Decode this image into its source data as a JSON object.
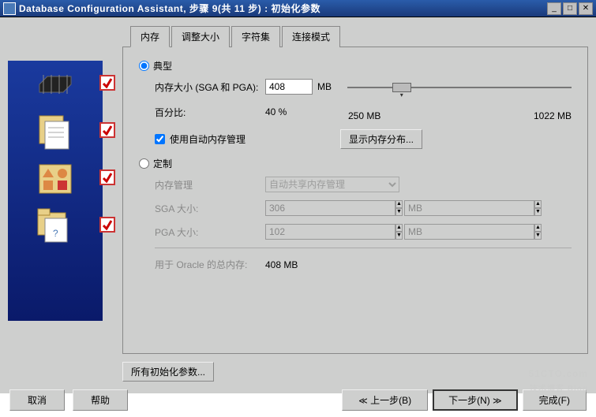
{
  "window": {
    "title": "Database Configuration Assistant, 步骤 9(共 11 步) : 初始化参数"
  },
  "tabs": {
    "t1": "内存",
    "t2": "调整大小",
    "t3": "字符集",
    "t4": "连接模式"
  },
  "memory": {
    "typical_label": "典型",
    "mem_size_label": "内存大小 (SGA 和 PGA):",
    "mem_size_value": "408",
    "mem_unit": "MB",
    "percent_label": "百分比:",
    "percent_value": "40 %",
    "slider_min": "250 MB",
    "slider_max": "1022 MB",
    "auto_mgmt_label": "使用自动内存管理",
    "show_dist_btn": "显示内存分布...",
    "custom_label": "定制",
    "mem_mgmt_label": "内存管理",
    "mem_mgmt_value": "自动共享内存管理",
    "sga_label": "SGA 大小:",
    "sga_value": "306",
    "pga_label": "PGA 大小:",
    "pga_value": "102",
    "unit_mb": "MB",
    "oracle_total_label": "用于 Oracle 的总内存:",
    "oracle_total_value": "408 MB",
    "all_params_btn": "所有初始化参数..."
  },
  "footer": {
    "cancel": "取消",
    "help": "帮助",
    "back": "上一步(B)",
    "next": "下一步(N)",
    "finish": "完成(F)"
  },
  "watermark": {
    "main": "51CTO.com",
    "sub": "技术博客 Blog"
  }
}
